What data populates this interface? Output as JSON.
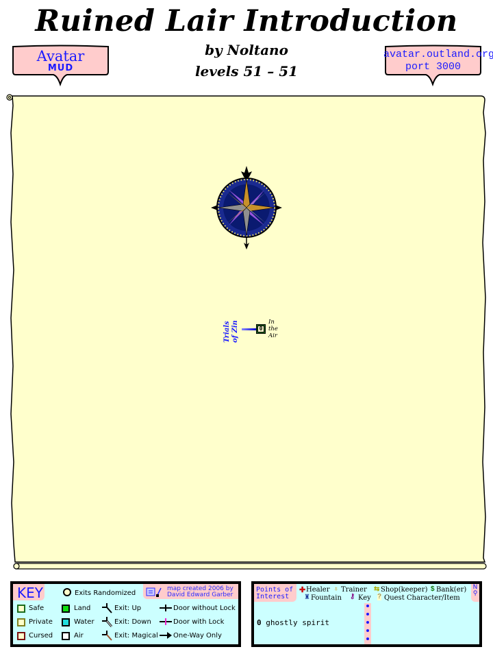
{
  "header": {
    "title": "Ruined Lair Introduction",
    "author_line": "by Noltano",
    "levels_line": "levels 51 – 51"
  },
  "banner_left": {
    "line1": "Avatar",
    "line2": "MUD"
  },
  "banner_right": {
    "line1": "avatar.outland.org",
    "line2": "port 3000"
  },
  "map": {
    "background_color": "#ffffcc",
    "compass_icon": "compass-rose-icon",
    "rooms": [
      {
        "id": "0",
        "label_lines": [
          "In",
          "the",
          "Air"
        ],
        "type": "Safe",
        "terrain": "Air"
      }
    ],
    "area_links": [
      {
        "lines": [
          "Trials",
          "of Zin"
        ],
        "direction": "west"
      }
    ]
  },
  "key": {
    "title": "KEY",
    "exits_randomized": "Exits Randomized",
    "credit_line1": "map created 2006 by",
    "credit_line2": "David Edward Garber",
    "room_types": [
      {
        "label": "Safe",
        "border": "#1b6b1b"
      },
      {
        "label": "Private",
        "border": "#808020"
      },
      {
        "label": "Cursed",
        "border": "#7a1010"
      }
    ],
    "terrains": [
      {
        "label": "Land",
        "color": "#11dd11"
      },
      {
        "label": "Water",
        "color": "#22dddd"
      },
      {
        "label": "Air",
        "color": "#ffffff"
      }
    ],
    "exits": [
      {
        "label": "Exit: Up"
      },
      {
        "label": "Exit: Down"
      },
      {
        "label": "Exit: Magical"
      }
    ],
    "doors": [
      {
        "label": "Door without Lock"
      },
      {
        "label": "Door with Lock"
      },
      {
        "label": "One-Way Only"
      }
    ]
  },
  "poi": {
    "title_line1": "Points of",
    "title_line2": "Interest",
    "legend": [
      {
        "icon": "healer-icon",
        "label": "Healer"
      },
      {
        "icon": "trainer-icon",
        "label": "Trainer"
      },
      {
        "icon": "shop-icon",
        "label": "Shop(keeper)"
      },
      {
        "icon": "bank-icon",
        "label": "Bank(er)"
      },
      {
        "icon": "fountain-icon",
        "label": "Fountain"
      },
      {
        "icon": "key-icon",
        "label": "Key"
      },
      {
        "icon": "quest-icon",
        "label": "Quest Character/Item"
      }
    ],
    "north_label": "N",
    "items": [
      {
        "id": "0",
        "text": "ghostly spirit"
      }
    ]
  }
}
